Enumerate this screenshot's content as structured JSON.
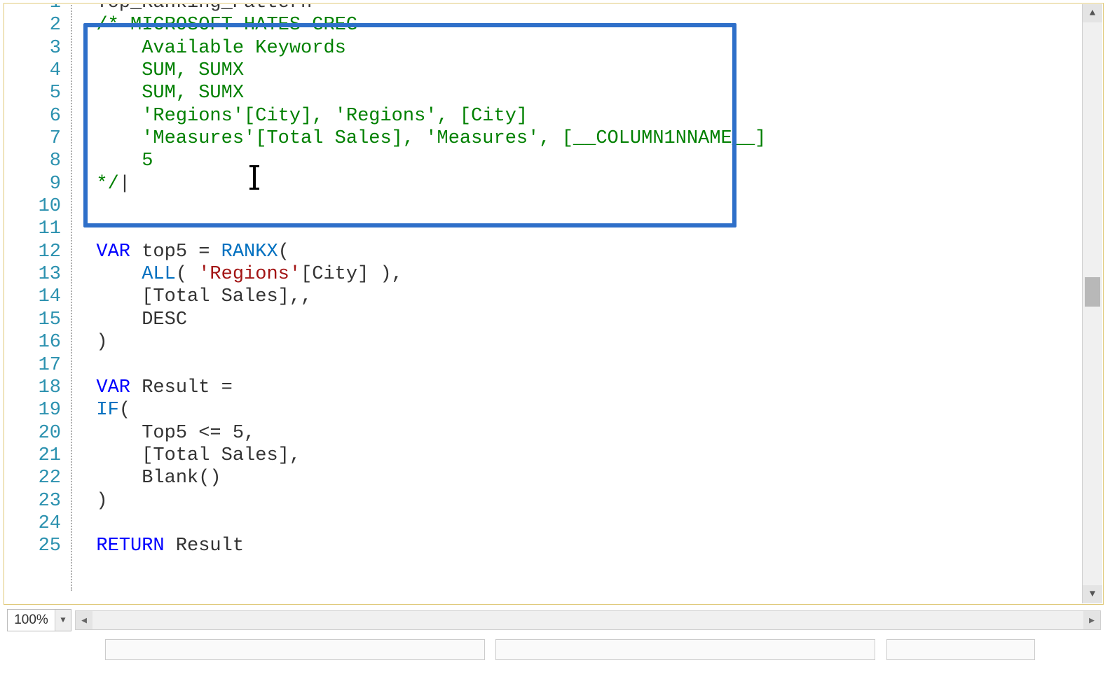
{
  "zoom": {
    "level": "100%"
  },
  "scroll": {
    "up": "▲",
    "down": "▼",
    "left": "◀",
    "right": "▶"
  },
  "code": {
    "lines": [
      {
        "n": 1,
        "segs": [
          {
            "t": "Top_Ranking_Pattern =",
            "cls": ""
          }
        ]
      },
      {
        "n": 2,
        "segs": [
          {
            "t": "/* MICROSOFT HATES GREG",
            "cls": "c-comment"
          }
        ]
      },
      {
        "n": 3,
        "segs": [
          {
            "t": "    Available Keywords",
            "cls": "c-comment"
          }
        ]
      },
      {
        "n": 4,
        "segs": [
          {
            "t": "    SUM, SUMX",
            "cls": "c-comment"
          }
        ]
      },
      {
        "n": 5,
        "segs": [
          {
            "t": "    SUM, SUMX",
            "cls": "c-comment"
          }
        ]
      },
      {
        "n": 6,
        "segs": [
          {
            "t": "    'Regions'[City], 'Regions', [City]",
            "cls": "c-comment"
          }
        ]
      },
      {
        "n": 7,
        "segs": [
          {
            "t": "    'Measures'[Total Sales], 'Measures', [__COLUMN1NNAME__]",
            "cls": "c-comment"
          }
        ]
      },
      {
        "n": 8,
        "segs": [
          {
            "t": "    5",
            "cls": "c-comment"
          }
        ]
      },
      {
        "n": 9,
        "segs": [
          {
            "t": "*/",
            "cls": "c-comment"
          },
          {
            "t": "|",
            "cls": ""
          }
        ]
      },
      {
        "n": 10,
        "segs": [
          {
            "t": "",
            "cls": ""
          }
        ]
      },
      {
        "n": 11,
        "segs": [
          {
            "t": "",
            "cls": ""
          }
        ]
      },
      {
        "n": 12,
        "segs": [
          {
            "t": "VAR",
            "cls": "c-kw"
          },
          {
            "t": " top5 = ",
            "cls": ""
          },
          {
            "t": "RANKX",
            "cls": "c-func"
          },
          {
            "t": "(",
            "cls": ""
          }
        ]
      },
      {
        "n": 13,
        "segs": [
          {
            "t": "    ",
            "cls": ""
          },
          {
            "t": "ALL",
            "cls": "c-func"
          },
          {
            "t": "( ",
            "cls": ""
          },
          {
            "t": "'Regions'",
            "cls": "c-str"
          },
          {
            "t": "[City] ),",
            "cls": ""
          }
        ]
      },
      {
        "n": 14,
        "segs": [
          {
            "t": "    [Total Sales],,",
            "cls": ""
          }
        ]
      },
      {
        "n": 15,
        "segs": [
          {
            "t": "    DESC",
            "cls": ""
          }
        ]
      },
      {
        "n": 16,
        "segs": [
          {
            "t": ")",
            "cls": ""
          }
        ]
      },
      {
        "n": 17,
        "segs": [
          {
            "t": "",
            "cls": ""
          }
        ]
      },
      {
        "n": 18,
        "segs": [
          {
            "t": "VAR",
            "cls": "c-kw"
          },
          {
            "t": " Result =",
            "cls": ""
          }
        ]
      },
      {
        "n": 19,
        "segs": [
          {
            "t": "IF",
            "cls": "c-func"
          },
          {
            "t": "(",
            "cls": ""
          }
        ]
      },
      {
        "n": 20,
        "segs": [
          {
            "t": "    Top5 <= 5,",
            "cls": ""
          }
        ]
      },
      {
        "n": 21,
        "segs": [
          {
            "t": "    [Total Sales],",
            "cls": ""
          }
        ]
      },
      {
        "n": 22,
        "segs": [
          {
            "t": "    Blank()",
            "cls": ""
          }
        ]
      },
      {
        "n": 23,
        "segs": [
          {
            "t": ")",
            "cls": ""
          }
        ]
      },
      {
        "n": 24,
        "segs": [
          {
            "t": "",
            "cls": ""
          }
        ]
      },
      {
        "n": 25,
        "segs": [
          {
            "t": "RETURN",
            "cls": "c-kw"
          },
          {
            "t": " Result",
            "cls": ""
          }
        ]
      }
    ]
  }
}
